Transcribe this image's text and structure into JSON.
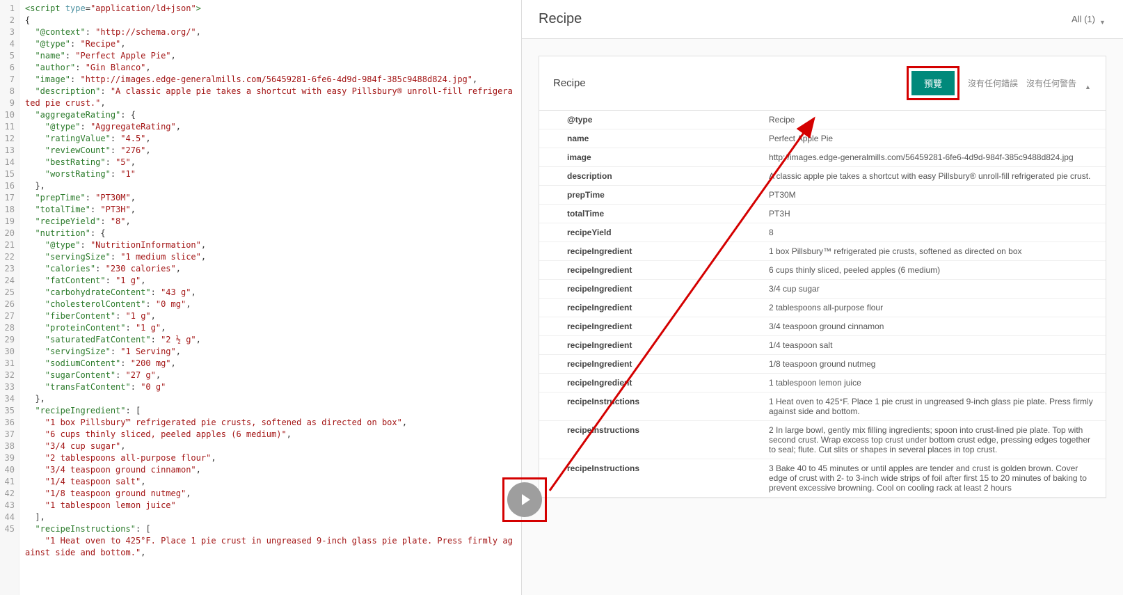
{
  "header": {
    "title": "Recipe",
    "dropdown": "All (1)"
  },
  "card": {
    "title": "Recipe",
    "preview_label": "預覽",
    "no_errors": "沒有任何錯誤",
    "no_warnings": "沒有任何警告"
  },
  "fields": [
    {
      "key": "@type",
      "val": "Recipe"
    },
    {
      "key": "name",
      "val": "Perfect Apple Pie"
    },
    {
      "key": "image",
      "val": "http://images.edge-generalmills.com/56459281-6fe6-4d9d-984f-385c9488d824.jpg"
    },
    {
      "key": "description",
      "val": "A classic apple pie takes a shortcut with easy Pillsbury® unroll-fill refrigerated pie crust."
    },
    {
      "key": "prepTime",
      "val": "PT30M"
    },
    {
      "key": "totalTime",
      "val": "PT3H"
    },
    {
      "key": "recipeYield",
      "val": "8"
    },
    {
      "key": "recipeIngredient",
      "val": "1 box Pillsbury™ refrigerated pie crusts, softened as directed on box"
    },
    {
      "key": "recipeIngredient",
      "val": "6 cups thinly sliced, peeled apples (6 medium)"
    },
    {
      "key": "recipeIngredient",
      "val": "3/4 cup sugar"
    },
    {
      "key": "recipeIngredient",
      "val": "2 tablespoons all-purpose flour"
    },
    {
      "key": "recipeIngredient",
      "val": "3/4 teaspoon ground cinnamon"
    },
    {
      "key": "recipeIngredient",
      "val": "1/4 teaspoon salt"
    },
    {
      "key": "recipeIngredient",
      "val": "1/8 teaspoon ground nutmeg"
    },
    {
      "key": "recipeIngredient",
      "val": "1 tablespoon lemon juice"
    },
    {
      "key": "recipeInstructions",
      "val": "1 Heat oven to 425°F. Place 1 pie crust in ungreased 9-inch glass pie plate. Press firmly against side and bottom."
    },
    {
      "key": "recipeInstructions",
      "val": "2 In large bowl, gently mix filling ingredients; spoon into crust-lined pie plate. Top with second crust. Wrap excess top crust under bottom crust edge, pressing edges together to seal; flute. Cut slits or shapes in several places in top crust."
    },
    {
      "key": "recipeInstructions",
      "val": "3 Bake 40 to 45 minutes or until apples are tender and crust is golden brown. Cover edge of crust with 2- to 3-inch wide strips of foil after first 15 to 20 minutes of baking to prevent excessive browning. Cool on cooling rack at least 2 hours"
    }
  ],
  "code_lines": [
    {
      "t": "tag",
      "c": "<script type=\"application/ld+json\">"
    },
    {
      "t": "plain",
      "c": "{"
    },
    {
      "t": "kv",
      "i": 1,
      "k": "@context",
      "v": "http://schema.org/",
      "comma": true
    },
    {
      "t": "kv",
      "i": 1,
      "k": "@type",
      "v": "Recipe",
      "comma": true
    },
    {
      "t": "kv",
      "i": 1,
      "k": "name",
      "v": "Perfect Apple Pie",
      "comma": true
    },
    {
      "t": "kv",
      "i": 1,
      "k": "author",
      "v": "Gin Blanco",
      "comma": true
    },
    {
      "t": "kv",
      "i": 1,
      "k": "image",
      "v": "http://images.edge-generalmills.com/56459281-6fe6-4d9d-984f-385c9488d824.jpg",
      "comma": true
    },
    {
      "t": "kv",
      "i": 1,
      "k": "description",
      "v": "A classic apple pie takes a shortcut with easy Pillsbury® unroll-fill refrigerated pie crust.",
      "comma": true
    },
    {
      "t": "ko",
      "i": 1,
      "k": "aggregateRating",
      "open": "{"
    },
    {
      "t": "kv",
      "i": 2,
      "k": "@type",
      "v": "AggregateRating",
      "comma": true
    },
    {
      "t": "kv",
      "i": 2,
      "k": "ratingValue",
      "v": "4.5",
      "comma": true
    },
    {
      "t": "kv",
      "i": 2,
      "k": "reviewCount",
      "v": "276",
      "comma": true
    },
    {
      "t": "kv",
      "i": 2,
      "k": "bestRating",
      "v": "5",
      "comma": true
    },
    {
      "t": "kv",
      "i": 2,
      "k": "worstRating",
      "v": "1"
    },
    {
      "t": "close",
      "i": 1,
      "c": "},"
    },
    {
      "t": "kv",
      "i": 1,
      "k": "prepTime",
      "v": "PT30M",
      "comma": true
    },
    {
      "t": "kv",
      "i": 1,
      "k": "totalTime",
      "v": "PT3H",
      "comma": true
    },
    {
      "t": "kv",
      "i": 1,
      "k": "recipeYield",
      "v": "8",
      "comma": true
    },
    {
      "t": "ko",
      "i": 1,
      "k": "nutrition",
      "open": "{"
    },
    {
      "t": "kv",
      "i": 2,
      "k": "@type",
      "v": "NutritionInformation",
      "comma": true
    },
    {
      "t": "kv",
      "i": 2,
      "k": "servingSize",
      "v": "1 medium slice",
      "comma": true
    },
    {
      "t": "kv",
      "i": 2,
      "k": "calories",
      "v": "230 calories",
      "comma": true
    },
    {
      "t": "kv",
      "i": 2,
      "k": "fatContent",
      "v": "1 g",
      "comma": true
    },
    {
      "t": "kv",
      "i": 2,
      "k": "carbohydrateContent",
      "v": "43 g",
      "comma": true
    },
    {
      "t": "kv",
      "i": 2,
      "k": "cholesterolContent",
      "v": "0 mg",
      "comma": true
    },
    {
      "t": "kv",
      "i": 2,
      "k": "fiberContent",
      "v": "1 g",
      "comma": true
    },
    {
      "t": "kv",
      "i": 2,
      "k": "proteinContent",
      "v": "1 g",
      "comma": true
    },
    {
      "t": "kv",
      "i": 2,
      "k": "saturatedFatContent",
      "v": "2 ½ g",
      "comma": true
    },
    {
      "t": "kv",
      "i": 2,
      "k": "servingSize",
      "v": "1 Serving",
      "comma": true
    },
    {
      "t": "kv",
      "i": 2,
      "k": "sodiumContent",
      "v": "200 mg",
      "comma": true
    },
    {
      "t": "kv",
      "i": 2,
      "k": "sugarContent",
      "v": "27 g",
      "comma": true
    },
    {
      "t": "kv",
      "i": 2,
      "k": "transFatContent",
      "v": "0 g"
    },
    {
      "t": "close",
      "i": 1,
      "c": "},"
    },
    {
      "t": "ko",
      "i": 1,
      "k": "recipeIngredient",
      "open": "["
    },
    {
      "t": "str",
      "i": 2,
      "v": "1 box Pillsbury™ refrigerated pie crusts, softened as directed on box",
      "comma": true
    },
    {
      "t": "str",
      "i": 2,
      "v": "6 cups thinly sliced, peeled apples (6 medium)",
      "comma": true
    },
    {
      "t": "str",
      "i": 2,
      "v": "3/4 cup sugar",
      "comma": true
    },
    {
      "t": "str",
      "i": 2,
      "v": "2 tablespoons all-purpose flour",
      "comma": true
    },
    {
      "t": "str",
      "i": 2,
      "v": "3/4 teaspoon ground cinnamon",
      "comma": true
    },
    {
      "t": "str",
      "i": 2,
      "v": "1/4 teaspoon salt",
      "comma": true
    },
    {
      "t": "str",
      "i": 2,
      "v": "1/8 teaspoon ground nutmeg",
      "comma": true
    },
    {
      "t": "str",
      "i": 2,
      "v": "1 tablespoon lemon juice"
    },
    {
      "t": "close",
      "i": 1,
      "c": "],"
    },
    {
      "t": "ko",
      "i": 1,
      "k": "recipeInstructions",
      "open": "["
    },
    {
      "t": "str",
      "i": 2,
      "v": "1 Heat oven to 425°F. Place 1 pie crust in ungreased 9-inch glass pie plate. Press firmly against side and bottom.",
      "comma": true
    }
  ]
}
